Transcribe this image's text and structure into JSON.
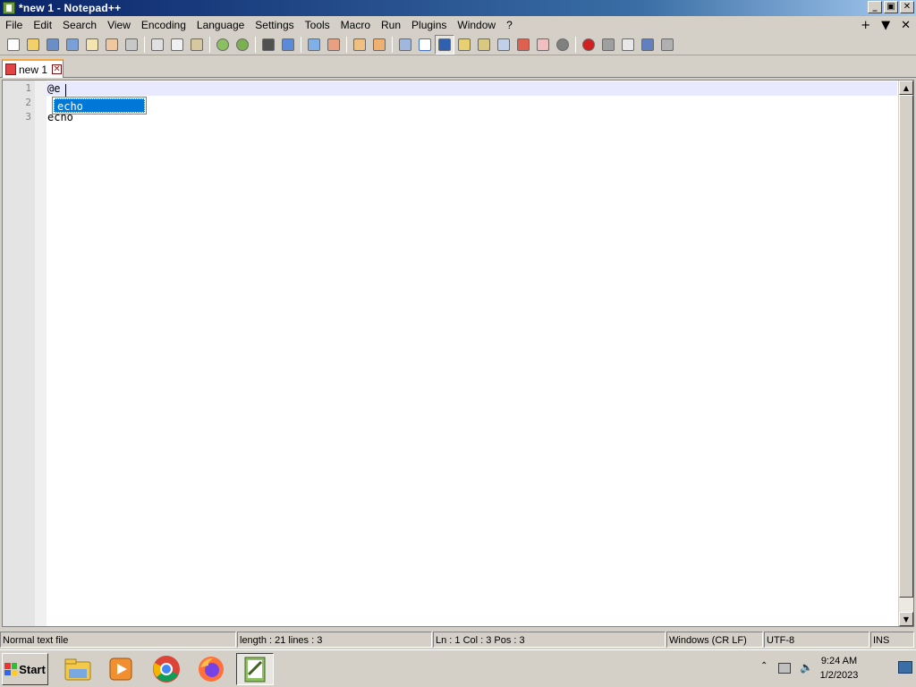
{
  "window": {
    "title": "*new 1 - Notepad++",
    "buttons": [
      "_",
      "▣",
      "✕"
    ]
  },
  "menu": {
    "items": [
      "File",
      "Edit",
      "Search",
      "View",
      "Encoding",
      "Language",
      "Settings",
      "Tools",
      "Macro",
      "Run",
      "Plugins",
      "Window",
      "?"
    ],
    "right": [
      "+",
      "▼",
      "✕"
    ]
  },
  "toolbar": {
    "icons": [
      "new-file-icon",
      "open-file-icon",
      "save-icon",
      "save-all-icon",
      "close-icon",
      "close-all-icon",
      "print-icon",
      "cut-icon",
      "copy-icon",
      "paste-icon",
      "undo-icon",
      "redo-icon",
      "find-icon",
      "replace-icon",
      "zoom-in-icon",
      "zoom-out-icon",
      "sync-vertical-icon",
      "sync-horizontal-icon",
      "word-wrap-icon",
      "show-all-chars-icon",
      "indent-guide-icon",
      "udl-icon",
      "doc-map-icon",
      "function-list-icon",
      "folder-as-workspace-icon",
      "doc-list-icon",
      "monitoring-icon",
      "record-macro-icon",
      "stop-record-icon",
      "playback-macro-icon",
      "run-macro-multiple-icon",
      "save-macro-icon"
    ]
  },
  "tabs": [
    {
      "label": "new 1",
      "close": "✕"
    }
  ],
  "editor": {
    "line_numbers": [
      "1",
      "2",
      "3"
    ],
    "lines": [
      "@e",
      "",
      "echo"
    ],
    "autocomplete": [
      "echo"
    ]
  },
  "status": {
    "filetype": "Normal text file",
    "length": "length : 21    lines : 3",
    "position": "Ln : 1    Col : 3    Pos : 3",
    "eol": "Windows (CR LF)",
    "encoding": "UTF-8",
    "mode": "INS"
  },
  "taskbar": {
    "start": "Start",
    "apps": [
      "file-explorer-icon",
      "media-player-icon",
      "chrome-icon",
      "firefox-icon",
      "notepadpp-icon"
    ],
    "time": "9:24 AM",
    "date": "1/2/2023"
  }
}
